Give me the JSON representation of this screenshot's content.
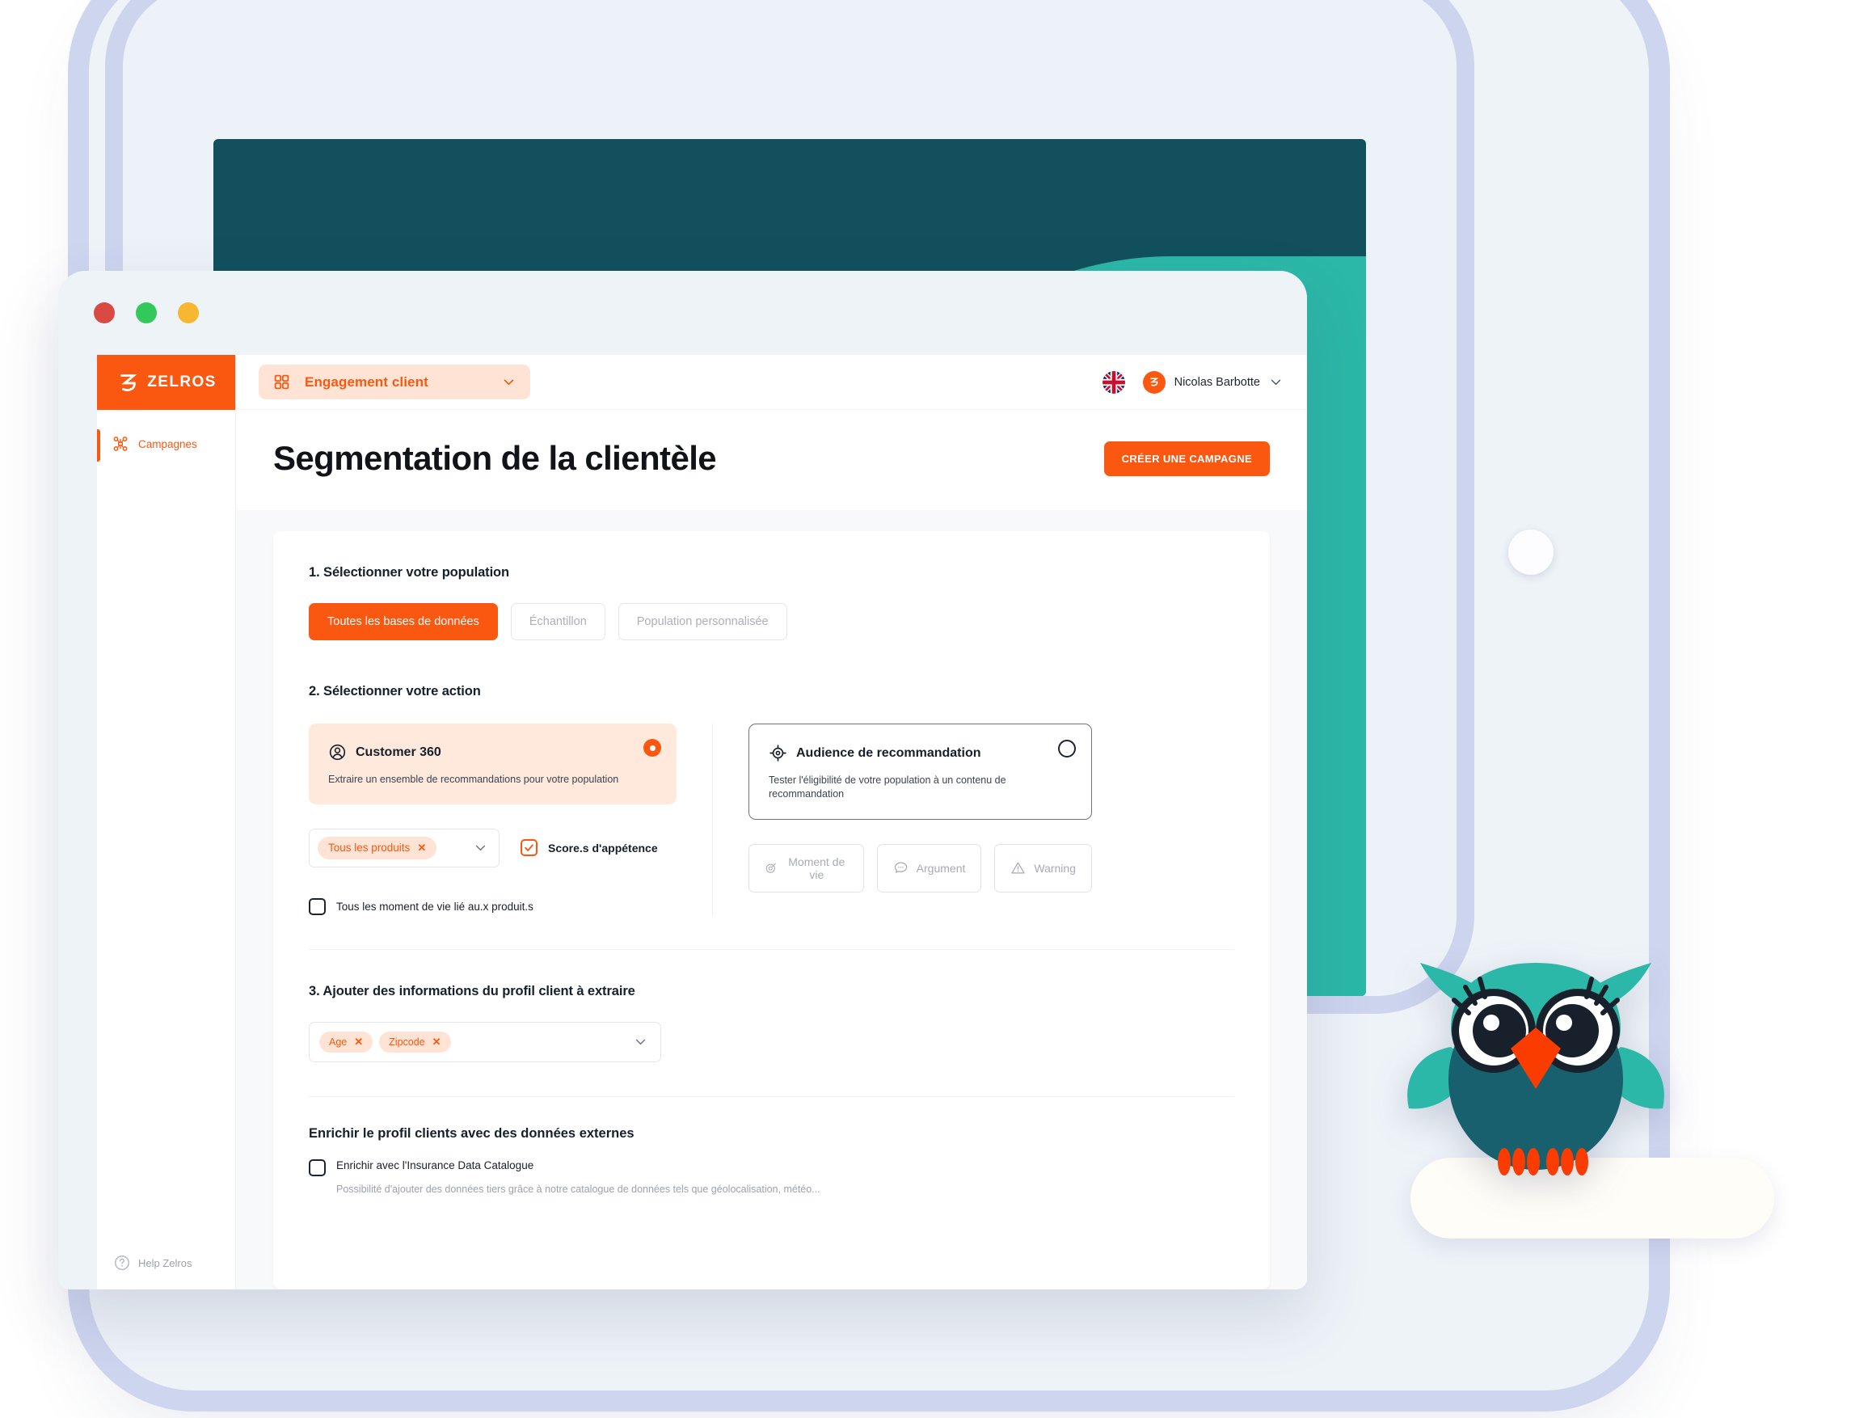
{
  "browser": {
    "dots": [
      "close",
      "minimize",
      "maximize"
    ]
  },
  "sidebar": {
    "logo_text": "ZELROS",
    "items": [
      {
        "label": "Campagnes",
        "icon": "campaign-nodes-icon",
        "active": true
      }
    ],
    "footer": {
      "label": "Help Zelros",
      "icon": "question-circle-icon"
    }
  },
  "topbar": {
    "module": {
      "label": "Engagement client",
      "icon": "grid-apps-icon",
      "chevron": "chevron-down-icon"
    },
    "language": {
      "icon": "uk-flag-icon",
      "value": "EN"
    },
    "user": {
      "name": "Nicolas Barbotte",
      "avatar_letter": "Z",
      "chevron": "chevron-down-icon"
    }
  },
  "page": {
    "title": "Segmentation de la clientèle",
    "cta_label": "CRÉER UNE CAMPAGNE"
  },
  "step1": {
    "title": "1. Sélectionner votre population",
    "options": [
      {
        "label": "Toutes les bases de données",
        "selected": true
      },
      {
        "label": "Échantillon",
        "selected": false
      },
      {
        "label": "Population personnalisée",
        "selected": false
      }
    ]
  },
  "step2": {
    "title": "2. Sélectionner votre action",
    "left_card": {
      "title": "Customer 360",
      "icon": "user-circle-icon",
      "description": "Extraire un ensemble de recommandations pour votre population",
      "selected": true
    },
    "right_card": {
      "title": "Audience de recommandation",
      "icon": "target-crosshair-icon",
      "description": "Tester l'éligibilité de votre population à un contenu de recommandation",
      "selected": false
    },
    "product_select": {
      "chips": [
        {
          "label": "Tous les produits"
        }
      ],
      "chevron": "chevron-down-icon"
    },
    "score_checkbox": {
      "label": "Score.s d'appétence",
      "checked": true
    },
    "moment_checkbox": {
      "label": "Tous les moment de vie lié au.x produit.s",
      "checked": false
    },
    "right_buttons": [
      {
        "label": "Moment de vie",
        "icon": "target-edit-icon"
      },
      {
        "label": "Argument",
        "icon": "chat-bubble-icon"
      },
      {
        "label": "Warning",
        "icon": "warning-triangle-icon"
      }
    ]
  },
  "step3": {
    "title": "3. Ajouter des informations du profil client à extraire",
    "chips": [
      {
        "label": "Age"
      },
      {
        "label": "Zipcode"
      }
    ],
    "chevron": "chevron-down-icon"
  },
  "enrich": {
    "title": "Enrichir le profil clients avec des données externes",
    "checkbox": {
      "label": "Enrichir avec l'Insurance Data Catalogue",
      "checked": false
    },
    "description": "Possibilité d'ajouter des données tiers grâce à notre catalogue de données tels que géolocalisation, météo..."
  },
  "mascot": {
    "name": "zelros-owl-mascot"
  },
  "colors": {
    "brand_orange": "#fa5811",
    "chip_bg": "#ffe3d4",
    "teal_dark": "#11505c",
    "teal_light": "#2bb8a8",
    "device_outline": "#ccd4ee"
  }
}
